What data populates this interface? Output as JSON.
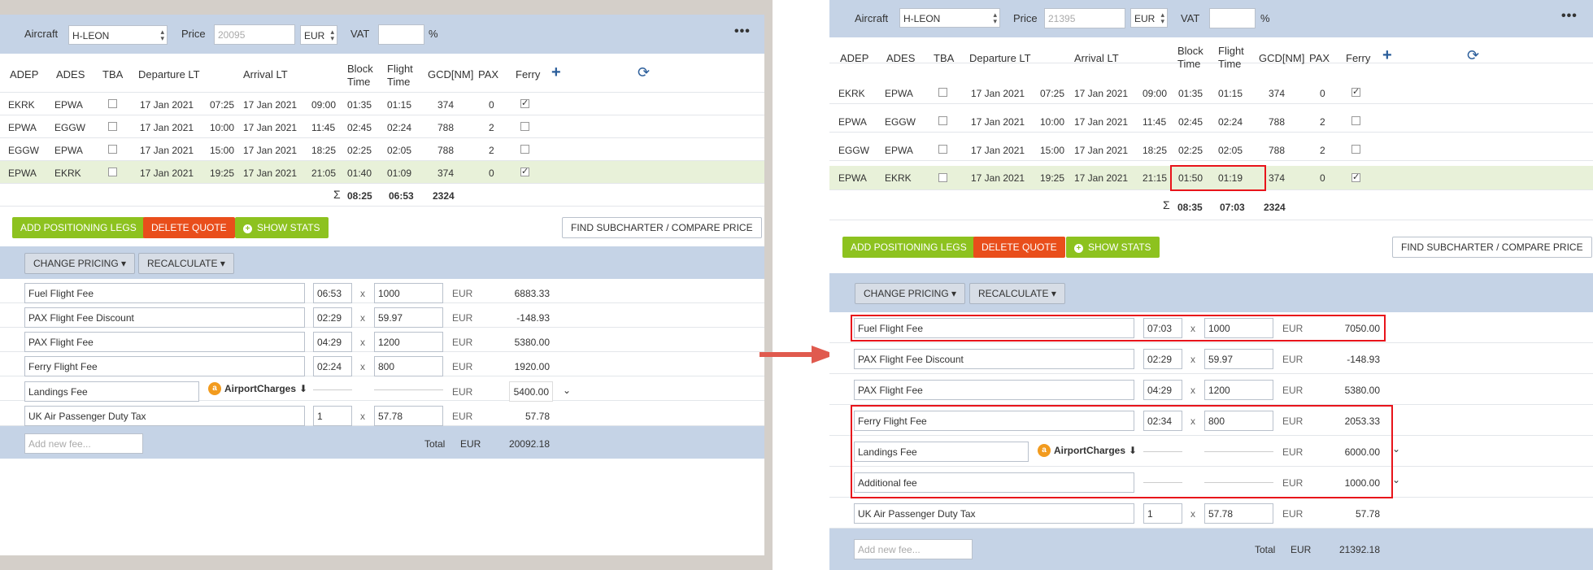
{
  "left": {
    "header": {
      "aircraft_label": "Aircraft",
      "aircraft_value": "H-LEON",
      "price_label": "Price",
      "price_placeholder": "20095",
      "currency": "EUR",
      "vat_label": "VAT",
      "vat_unit": "%"
    },
    "columns": [
      "ADEP",
      "ADES",
      "TBA",
      "Departure LT",
      "Arrival LT",
      "Block Time",
      "Flight Time",
      "GCD[NM]",
      "PAX",
      "Ferry"
    ],
    "legs": [
      {
        "adep": "EKRK",
        "ades": "EPWA",
        "dep_date": "17 Jan 2021",
        "dep_time": "07:25",
        "arr_date": "17 Jan 2021",
        "arr_time": "09:00",
        "block": "01:35",
        "flight": "01:15",
        "gcd": "374",
        "pax": "0",
        "ferry": true
      },
      {
        "adep": "EPWA",
        "ades": "EGGW",
        "dep_date": "17 Jan 2021",
        "dep_time": "10:00",
        "arr_date": "17 Jan 2021",
        "arr_time": "11:45",
        "block": "02:45",
        "flight": "02:24",
        "gcd": "788",
        "pax": "2",
        "ferry": false
      },
      {
        "adep": "EGGW",
        "ades": "EPWA",
        "dep_date": "17 Jan 2021",
        "dep_time": "15:00",
        "arr_date": "17 Jan 2021",
        "arr_time": "18:25",
        "block": "02:25",
        "flight": "02:05",
        "gcd": "788",
        "pax": "2",
        "ferry": false
      },
      {
        "adep": "EPWA",
        "ades": "EKRK",
        "dep_date": "17 Jan 2021",
        "dep_time": "19:25",
        "arr_date": "17 Jan 2021",
        "arr_time": "21:05",
        "block": "01:40",
        "flight": "01:09",
        "gcd": "374",
        "pax": "0",
        "ferry": true
      }
    ],
    "totals": {
      "sigma": "Σ",
      "block": "08:25",
      "flight": "06:53",
      "gcd": "2324"
    },
    "buttons": {
      "add_positioning": "ADD POSITIONING LEGS",
      "delete_quote": "DELETE QUOTE",
      "show_stats": "SHOW STATS",
      "find_subcharter": "FIND SUBCHARTER / COMPARE PRICE",
      "change_pricing": "CHANGE PRICING",
      "recalculate": "RECALCULATE"
    },
    "fees": [
      {
        "name": "Fuel Flight Fee",
        "qty": "06:53",
        "rate": "1000",
        "cur": "EUR",
        "total": "6883.33"
      },
      {
        "name": "PAX Flight Fee Discount",
        "qty": "02:29",
        "rate": "59.97",
        "cur": "EUR",
        "total": "-148.93"
      },
      {
        "name": "PAX Flight Fee",
        "qty": "04:29",
        "rate": "1200",
        "cur": "EUR",
        "total": "5380.00"
      },
      {
        "name": "Ferry Flight Fee",
        "qty": "02:24",
        "rate": "800",
        "cur": "EUR",
        "total": "1920.00"
      },
      {
        "name": "Landings Fee",
        "provider": "AirportCharges",
        "cur": "EUR",
        "total": "5400.00"
      },
      {
        "name": "UK Air Passenger Duty Tax",
        "qty": "1",
        "rate": "57.78",
        "cur": "EUR",
        "total": "57.78"
      }
    ],
    "footer": {
      "add_fee_placeholder": "Add new fee...",
      "total_label": "Total",
      "cur": "EUR",
      "total": "20092.18"
    }
  },
  "right": {
    "header": {
      "aircraft_label": "Aircraft",
      "aircraft_value": "H-LEON",
      "price_label": "Price",
      "price_placeholder": "21395",
      "currency": "EUR",
      "vat_label": "VAT",
      "vat_unit": "%"
    },
    "columns": [
      "ADEP",
      "ADES",
      "TBA",
      "Departure LT",
      "Arrival LT",
      "Block Time",
      "Flight Time",
      "GCD[NM]",
      "PAX",
      "Ferry"
    ],
    "legs": [
      {
        "adep": "EKRK",
        "ades": "EPWA",
        "dep_date": "17 Jan 2021",
        "dep_time": "07:25",
        "arr_date": "17 Jan 2021",
        "arr_time": "09:00",
        "block": "01:35",
        "flight": "01:15",
        "gcd": "374",
        "pax": "0",
        "ferry": true
      },
      {
        "adep": "EPWA",
        "ades": "EGGW",
        "dep_date": "17 Jan 2021",
        "dep_time": "10:00",
        "arr_date": "17 Jan 2021",
        "arr_time": "11:45",
        "block": "02:45",
        "flight": "02:24",
        "gcd": "788",
        "pax": "2",
        "ferry": false
      },
      {
        "adep": "EGGW",
        "ades": "EPWA",
        "dep_date": "17 Jan 2021",
        "dep_time": "15:00",
        "arr_date": "17 Jan 2021",
        "arr_time": "18:25",
        "block": "02:25",
        "flight": "02:05",
        "gcd": "788",
        "pax": "2",
        "ferry": false
      },
      {
        "adep": "EPWA",
        "ades": "EKRK",
        "dep_date": "17 Jan 2021",
        "dep_time": "19:25",
        "arr_date": "17 Jan 2021",
        "arr_time": "21:15",
        "block": "01:50",
        "flight": "01:19",
        "gcd": "374",
        "pax": "0",
        "ferry": true
      }
    ],
    "totals": {
      "sigma": "Σ",
      "block": "08:35",
      "flight": "07:03",
      "gcd": "2324"
    },
    "buttons": {
      "add_positioning": "ADD POSITIONING LEGS",
      "delete_quote": "DELETE QUOTE",
      "show_stats": "SHOW STATS",
      "find_subcharter": "FIND SUBCHARTER / COMPARE PRICE",
      "change_pricing": "CHANGE PRICING",
      "recalculate": "RECALCULATE"
    },
    "fees": [
      {
        "name": "Fuel Flight Fee",
        "qty": "07:03",
        "rate": "1000",
        "cur": "EUR",
        "total": "7050.00"
      },
      {
        "name": "PAX Flight Fee Discount",
        "qty": "02:29",
        "rate": "59.97",
        "cur": "EUR",
        "total": "-148.93"
      },
      {
        "name": "PAX Flight Fee",
        "qty": "04:29",
        "rate": "1200",
        "cur": "EUR",
        "total": "5380.00"
      },
      {
        "name": "Ferry Flight Fee",
        "qty": "02:34",
        "rate": "800",
        "cur": "EUR",
        "total": "2053.33"
      },
      {
        "name": "Landings Fee",
        "provider": "AirportCharges",
        "cur": "EUR",
        "total": "6000.00"
      },
      {
        "name": "Additional fee",
        "cur": "EUR",
        "total": "1000.00"
      },
      {
        "name": "UK Air Passenger Duty Tax",
        "qty": "1",
        "rate": "57.78",
        "cur": "EUR",
        "total": "57.78"
      }
    ],
    "footer": {
      "add_fee_placeholder": "Add new fee...",
      "total_label": "Total",
      "cur": "EUR",
      "total": "21392.18"
    }
  },
  "symbols": {
    "times": "x",
    "plus": "+",
    "refresh": "⟳",
    "dots": "•••",
    "caret": "▾",
    "chevron_down": "⌄",
    "airport_logo": "a",
    "download": "⬇"
  },
  "colors": {
    "header_band": "#c5d3e6",
    "highlight_row": "#e8f1d9",
    "green_button": "#8dc21f",
    "red_button": "#e94e1b",
    "annotation_red": "#e8141b"
  }
}
